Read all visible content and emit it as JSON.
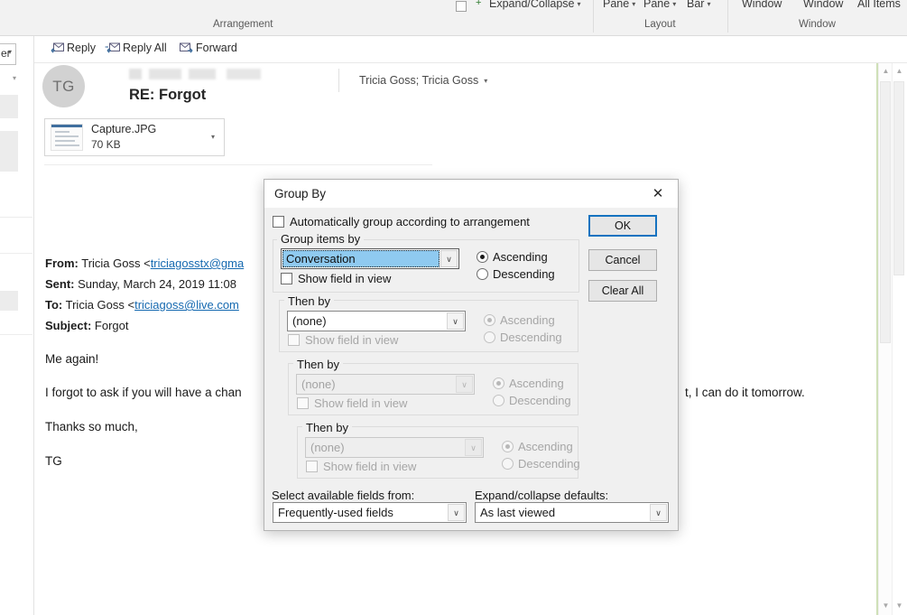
{
  "ribbon": {
    "items": [
      {
        "label": "Expand/Collapse",
        "caret": "▾"
      },
      {
        "label": "Pane",
        "caret": "▾"
      },
      {
        "label": "Pane",
        "caret": "▾"
      },
      {
        "label": "Bar",
        "caret": "▾"
      },
      {
        "label": "Window",
        "caret": ""
      },
      {
        "label": "Window",
        "caret": ""
      },
      {
        "label": "All Items",
        "caret": ""
      }
    ],
    "groups": [
      {
        "label": "Arrangement"
      },
      {
        "label": "Layout"
      },
      {
        "label": "Window"
      }
    ]
  },
  "left_rail": {
    "dropdown_label": "er",
    "dropdown_caret": "▾"
  },
  "reading_pane": {
    "commands": [
      {
        "label": "Reply",
        "icon": "reply-icon"
      },
      {
        "label": "Reply All",
        "icon": "reply-all-icon"
      },
      {
        "label": "Forward",
        "icon": "forward-icon"
      }
    ],
    "avatar_initials": "TG",
    "subject": "RE: Forgot",
    "recipients": "Tricia Goss; Tricia Goss",
    "recipients_caret": "▾",
    "attachment": {
      "name": "Capture.JPG",
      "size": "70 KB",
      "caret": "▾"
    },
    "headers": [
      {
        "label": "From:",
        "value": "Tricia Goss <",
        "link": "triciagosstx@gma"
      },
      {
        "label": "Sent:",
        "value": "Sunday, March 24, 2019 11:08",
        "link": ""
      },
      {
        "label": "To:",
        "value": "Tricia Goss <",
        "link": "triciagoss@live.com"
      },
      {
        "label": "Subject:",
        "value": "Forgot",
        "link": ""
      }
    ],
    "body": [
      "Me again!",
      "I forgot to ask if you will have a chan",
      "Thanks so much,",
      "TG"
    ],
    "body_overflow": "t, I can do it tomorrow."
  },
  "dialog": {
    "title": "Group By",
    "close_icon": "✕",
    "auto_group": {
      "label": "Automatically group according to arrangement",
      "checked": false
    },
    "group_items_by": {
      "legend": "Group items by",
      "value": "Conversation",
      "show_field_label": "Show field in view",
      "show_field_checked": false,
      "sort": {
        "ascending_label": "Ascending",
        "descending_label": "Descending",
        "selected": "Ascending"
      }
    },
    "then_by": [
      {
        "legend": "Then by",
        "value": "(none)",
        "disabled": false,
        "show_field_label": "Show field in view",
        "sort": {
          "ascending_label": "Ascending",
          "descending_label": "Descending",
          "selected": "Ascending"
        }
      },
      {
        "legend": "Then by",
        "value": "(none)",
        "disabled": true,
        "show_field_label": "Show field in view",
        "sort": {
          "ascending_label": "Ascending",
          "descending_label": "Descending",
          "selected": "Ascending"
        }
      },
      {
        "legend": "Then by",
        "value": "(none)",
        "disabled": true,
        "show_field_label": "Show field in view",
        "sort": {
          "ascending_label": "Ascending",
          "descending_label": "Descending",
          "selected": "Ascending"
        }
      }
    ],
    "bottom": {
      "select_fields_label": "Select available fields from:",
      "select_fields_value": "Frequently-used fields",
      "expand_collapse_label": "Expand/collapse defaults:",
      "expand_collapse_value": "As last viewed"
    },
    "buttons": [
      {
        "label": "OK",
        "focused": true
      },
      {
        "label": "Cancel",
        "focused": false
      },
      {
        "label": "Clear All",
        "focused": false
      }
    ],
    "arrow_glyph": "∨"
  },
  "colors": {
    "accent_blue": "#1673c0",
    "selection_blue": "#8fcaf0",
    "dialog_bg": "#f0f0f0",
    "link": "#1569b0"
  }
}
